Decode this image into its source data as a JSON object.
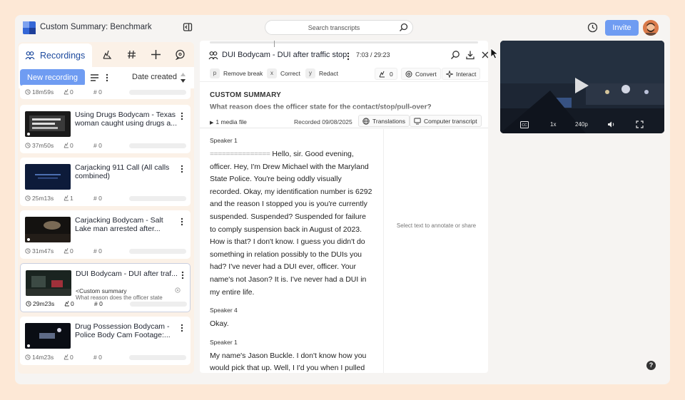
{
  "app": {
    "title": "Custom Summary: Benchmark"
  },
  "header": {
    "search_placeholder": "Search transcripts",
    "invite_label": "Invite"
  },
  "left": {
    "tab_recordings": "Recordings",
    "new_recording": "New recording",
    "sort_label": "Date created",
    "top_partial": {
      "duration": "18m59s",
      "likes": "0",
      "hash": "# 0"
    },
    "recordings": [
      {
        "title": "Using Drugs Bodycam - Texas woman caught using drugs a...",
        "duration": "37m50s",
        "likes": "0",
        "hash": "# 0"
      },
      {
        "title": "Carjacking 911 Call (All calls combined)",
        "duration": "25m13s",
        "likes": "1",
        "hash": "# 0"
      },
      {
        "title": "Carjacking Bodycam - Salt Lake man arrested after...",
        "duration": "31m47s",
        "likes": "0",
        "hash": "# 0"
      },
      {
        "title": "DUI Bodycam - DUI after traf...",
        "sub1": "<Custom summary",
        "sub2": "What reason does the officer state",
        "duration": "29m23s",
        "likes": "0",
        "hash": "# 0"
      },
      {
        "title": "Drug Possession Bodycam - Police Body Cam Footage:...",
        "duration": "14m23s",
        "likes": "0",
        "hash": "# 0"
      }
    ]
  },
  "main": {
    "title": "DUI Bodycam - DUI after traffic stop",
    "time": "7:03 / 29:23",
    "shortcuts": [
      {
        "key": "p",
        "label": "Remove break"
      },
      {
        "key": "x",
        "label": "Correct"
      },
      {
        "key": "y",
        "label": "Redact"
      }
    ],
    "actions": {
      "likes": "0",
      "convert": "Convert",
      "interact": "Interact"
    },
    "summary_heading": "CUSTOM SUMMARY",
    "summary_question": "What reason does the officer state for the contact/stop/pull-over?",
    "media_files": "1 media file",
    "recorded": "Recorded 09/08/2025",
    "translations": "Translations",
    "computer_transcript": "Computer transcript",
    "side_hint": "Select text to annotate or share",
    "transcript": [
      {
        "speaker": "Speaker 1",
        "dashes": "===============",
        "text": " Hello, sir. Good evening, officer. Hey, I'm Drew Michael with the Maryland State Police. You're being oddly visually recorded. Okay, my identification number is 6292 and the reason I stopped you is you're currently suspended. Suspended? Suspended for failure to comply suspension back in August of 2023. How is that? I don't know. I guess you didn't do something in relation possibly to the DUIs you had? I've never had a DUI ever, officer. Your name's not Jason? It is. I've never had a DUI in my entire life."
      },
      {
        "speaker": "Speaker 4",
        "dashes": "",
        "text": "Okay."
      },
      {
        "speaker": "Speaker 1",
        "dashes": "",
        "text": "My name's Jason Buckle. I don't know how you would pick that up. Well, I I'd you when I pulled"
      }
    ]
  },
  "video": {
    "speed": "1x",
    "quality": "240p"
  },
  "colors": {
    "accent": "#6f9cf2",
    "background": "#fde8d6",
    "tab_text": "#1d4a9e"
  }
}
